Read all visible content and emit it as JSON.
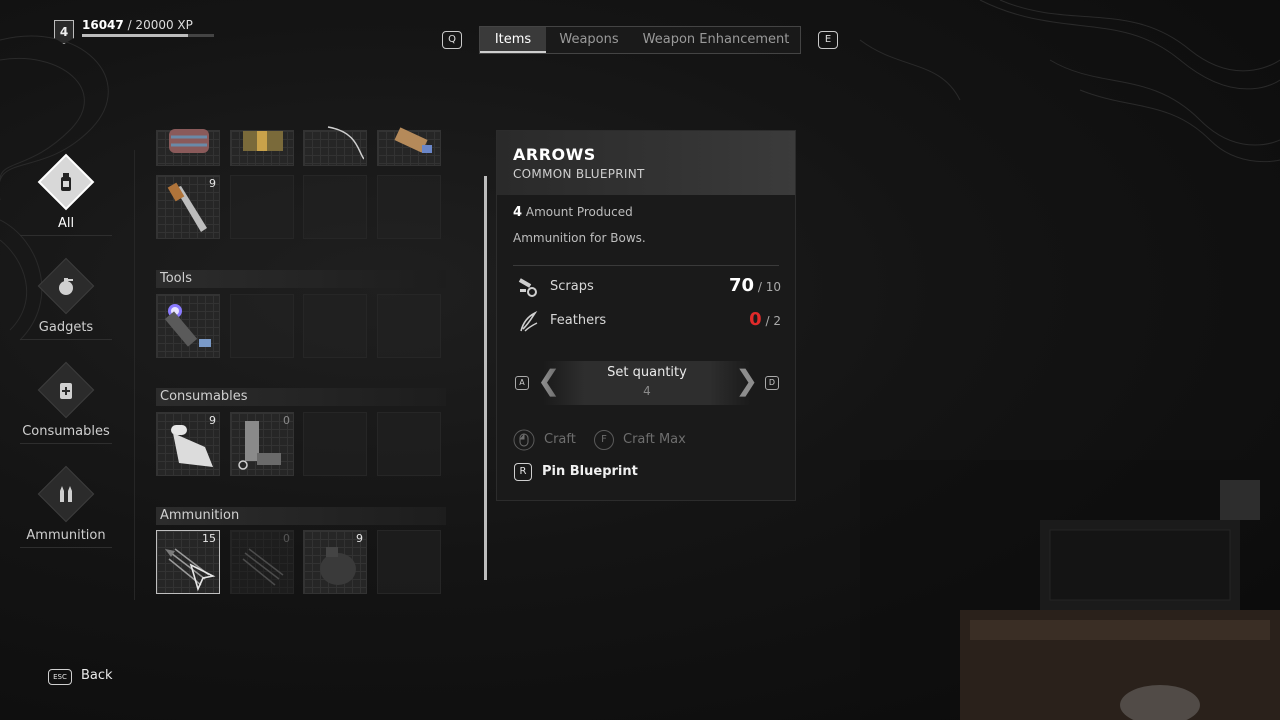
{
  "player": {
    "level": "4",
    "xp_current": "16047",
    "xp_total": "/ 20000 XP",
    "xp_progress": 0.8
  },
  "tabs": {
    "prev_key": "Q",
    "next_key": "E",
    "items": [
      {
        "label": "Items",
        "active": true
      },
      {
        "label": "Weapons",
        "active": false
      },
      {
        "label": "Weapon Enhancement",
        "active": false
      }
    ]
  },
  "categories": [
    {
      "label": "All",
      "icon": "bottle-icon",
      "active": true
    },
    {
      "label": "Gadgets",
      "icon": "grenade-icon",
      "active": false
    },
    {
      "label": "Consumables",
      "icon": "medkit-icon",
      "active": false
    },
    {
      "label": "Ammunition",
      "icon": "bullets-icon",
      "active": false
    }
  ],
  "inventory": {
    "top_row": [
      {
        "icon": "cloth-bundle-icon"
      },
      {
        "icon": "wrapped-package-icon"
      },
      {
        "icon": "wire-icon"
      },
      {
        "icon": "torch-wrap-icon"
      }
    ],
    "knife": {
      "icon": "throwing-knife-icon",
      "count": "9"
    },
    "sections": {
      "tools": "Tools",
      "consumables": "Consumables",
      "ammunition": "Ammunition"
    },
    "tools": [
      {
        "icon": "flashlight-icon"
      }
    ],
    "consumables": [
      {
        "icon": "bandage-icon",
        "count": "9"
      },
      {
        "icon": "canister-icon",
        "count": "0"
      }
    ],
    "ammunition": [
      {
        "icon": "arrows-icon",
        "count": "15"
      },
      {
        "icon": "arrows-icon",
        "count": "0"
      },
      {
        "icon": "pouch-icon",
        "count": "9"
      }
    ]
  },
  "detail": {
    "title": "ARROWS",
    "subtitle": "COMMON BLUEPRINT",
    "amount": "4",
    "amount_label": "Amount Produced",
    "description": "Ammunition for Bows.",
    "resources": [
      {
        "name": "Scraps",
        "have": "70",
        "need": "/ 10",
        "sufficient": true,
        "icon": "scraps-icon"
      },
      {
        "name": "Feathers",
        "have": "0",
        "need": "/ 2",
        "sufficient": false,
        "icon": "feathers-icon"
      }
    ],
    "quantity_label": "Set quantity",
    "quantity_value": "4",
    "dec_key": "A",
    "inc_key": "D",
    "craft_label": "Craft",
    "craft_max_key": "F",
    "craft_max_label": "Craft Max",
    "pin_key": "R",
    "pin_label": "Pin Blueprint"
  },
  "footer": {
    "esc_key": "ESC",
    "back_label": "Back"
  },
  "colors": {
    "accent": "#d8d8d8",
    "insufficient": "#e02a2a",
    "panel": "#1a1a1a"
  }
}
